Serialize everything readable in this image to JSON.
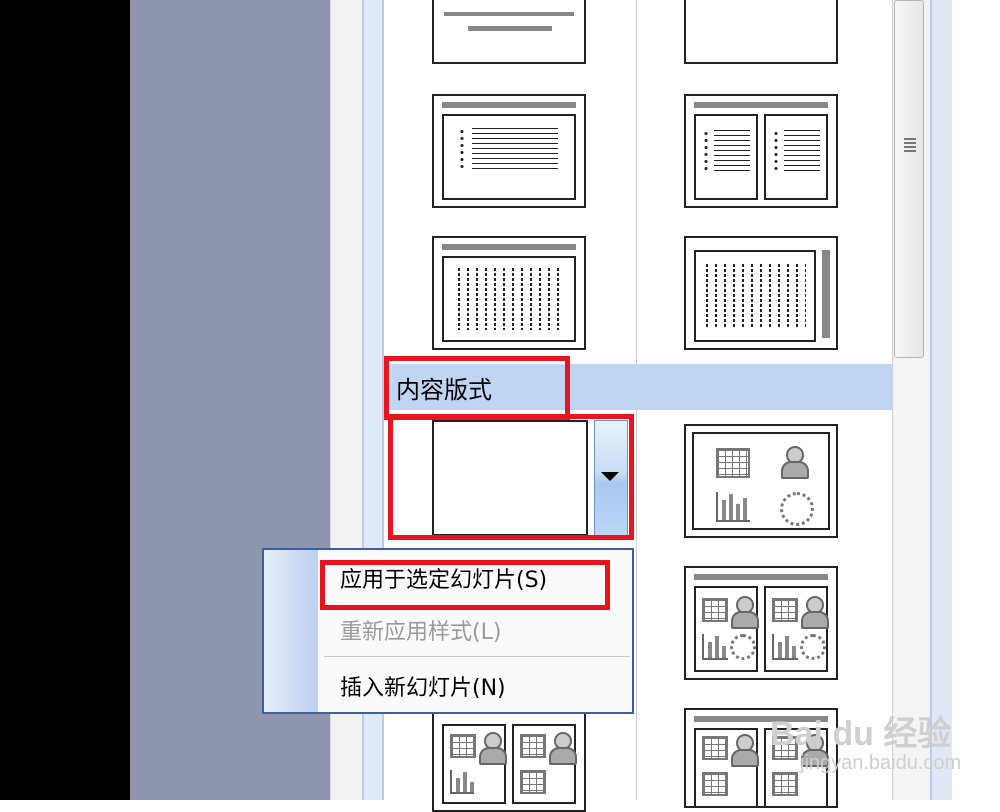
{
  "panel": {
    "section_title": "内容版式"
  },
  "context_menu": {
    "items": [
      {
        "label": "应用于选定幻灯片(S)",
        "enabled": true
      },
      {
        "label": "重新应用样式(L)",
        "enabled": false
      },
      {
        "label": "插入新幻灯片(N)",
        "enabled": true
      }
    ]
  },
  "watermark": {
    "brand": "Bai du 经验",
    "url": "jingyan.baidu.com"
  },
  "colors": {
    "highlight_red": "#e8141f",
    "section_header_bg": "#c0d5f2",
    "menu_border": "#3b5fa4"
  }
}
